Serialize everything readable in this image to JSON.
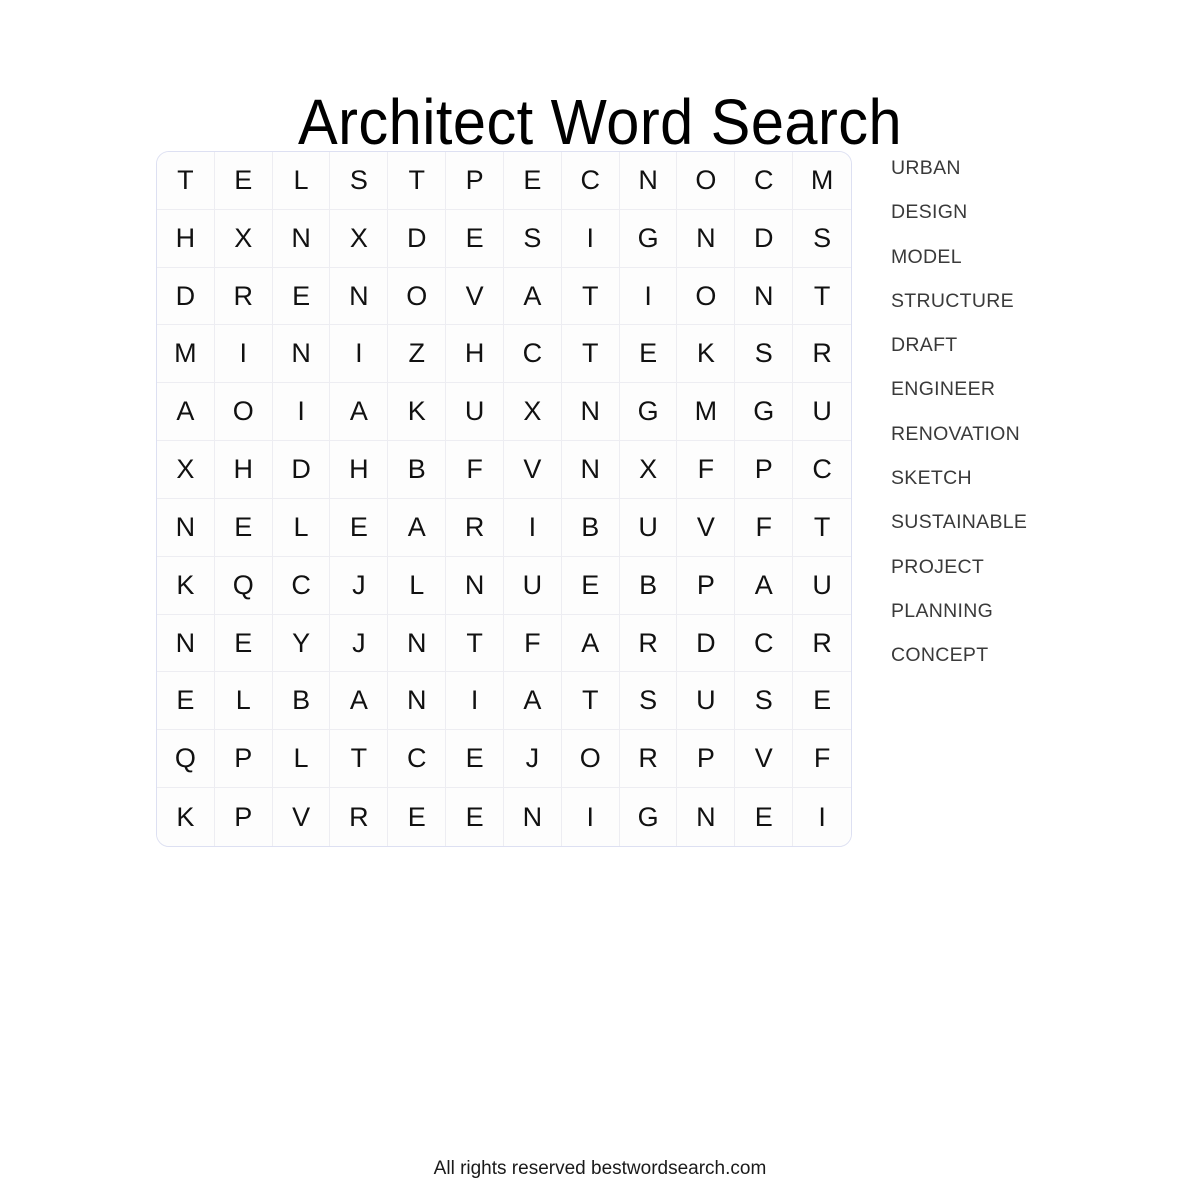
{
  "title": "Architect Word Search",
  "footer": "All rights reserved bestwordsearch.com",
  "colors": {
    "page_background": "#ffffff",
    "grid_border": "#dde0f2",
    "grid_lines": "#ededf2",
    "letter": "#111111",
    "word_text": "#3a3a3a",
    "title": "#000000"
  },
  "grid": {
    "rows": 12,
    "cols": 12,
    "letters": [
      [
        "T",
        "E",
        "L",
        "S",
        "T",
        "P",
        "E",
        "C",
        "N",
        "O",
        "C",
        "M"
      ],
      [
        "H",
        "X",
        "N",
        "X",
        "D",
        "E",
        "S",
        "I",
        "G",
        "N",
        "D",
        "S"
      ],
      [
        "D",
        "R",
        "E",
        "N",
        "O",
        "V",
        "A",
        "T",
        "I",
        "O",
        "N",
        "T"
      ],
      [
        "M",
        "I",
        "N",
        "I",
        "Z",
        "H",
        "C",
        "T",
        "E",
        "K",
        "S",
        "R"
      ],
      [
        "A",
        "O",
        "I",
        "A",
        "K",
        "U",
        "X",
        "N",
        "G",
        "M",
        "G",
        "U"
      ],
      [
        "X",
        "H",
        "D",
        "H",
        "B",
        "F",
        "V",
        "N",
        "X",
        "F",
        "P",
        "C"
      ],
      [
        "N",
        "E",
        "L",
        "E",
        "A",
        "R",
        "I",
        "B",
        "U",
        "V",
        "F",
        "T"
      ],
      [
        "K",
        "Q",
        "C",
        "J",
        "L",
        "N",
        "U",
        "E",
        "B",
        "P",
        "A",
        "U"
      ],
      [
        "N",
        "E",
        "Y",
        "J",
        "N",
        "T",
        "F",
        "A",
        "R",
        "D",
        "C",
        "R"
      ],
      [
        "E",
        "L",
        "B",
        "A",
        "N",
        "I",
        "A",
        "T",
        "S",
        "U",
        "S",
        "E"
      ],
      [
        "Q",
        "P",
        "L",
        "T",
        "C",
        "E",
        "J",
        "O",
        "R",
        "P",
        "V",
        "F"
      ],
      [
        "K",
        "P",
        "V",
        "R",
        "E",
        "E",
        "N",
        "I",
        "G",
        "N",
        "E",
        "I"
      ]
    ]
  },
  "wordlist": {
    "words": [
      "URBAN",
      "DESIGN",
      "MODEL",
      "STRUCTURE",
      "DRAFT",
      "ENGINEER",
      "RENOVATION",
      "SKETCH",
      "SUSTAINABLE",
      "PROJECT",
      "PLANNING",
      "CONCEPT"
    ]
  }
}
